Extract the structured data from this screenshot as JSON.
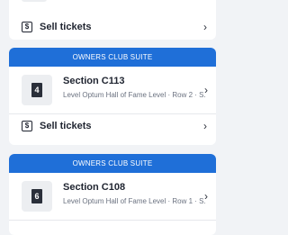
{
  "sell_label": "Sell tickets",
  "sell_icon": "dollar-ticket-icon",
  "chevron_icon": "chevron-right-icon",
  "cards": [
    {
      "header": "OWNERS CLUB SUITE",
      "ticket_number": "4",
      "section": "Section C113",
      "details": "Level Optum Hall of Fame Level · Row 2 · S..."
    },
    {
      "header": "OWNERS CLUB SUITE",
      "ticket_number": "6",
      "section": "Section C108",
      "details": "Level Optum Hall of Fame Level · Row 1 · S..."
    }
  ],
  "colors": {
    "accent": "#1f6fd8",
    "background": "#f1f3f6",
    "card": "#ffffff"
  }
}
